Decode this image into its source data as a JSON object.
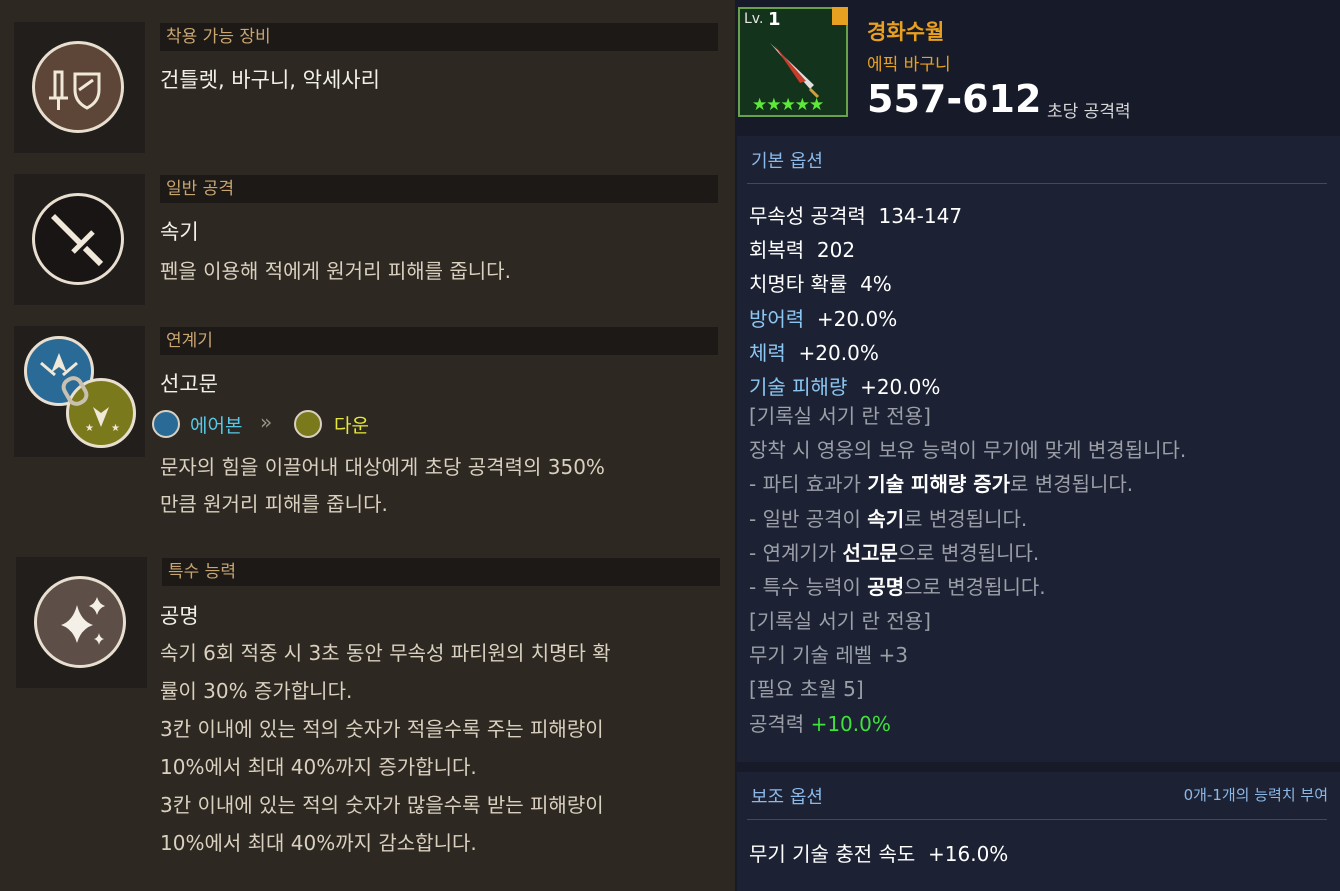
{
  "sections": {
    "equip": {
      "header": "착용 가능 장비",
      "title": "건틀렛, 바구니, 악세사리"
    },
    "attack": {
      "header": "일반 공격",
      "title": "속기",
      "desc": "펜을 이용해 적에게 원거리 피해를 줍니다."
    },
    "chain": {
      "header": "연계기",
      "title": "선고문",
      "from": "에어본",
      "to": "다운",
      "desc1": "문자의 힘을 이끌어내 대상에게 초당 공격력의 350%",
      "desc2": "만큼 원거리 피해를 줍니다."
    },
    "special": {
      "header": "특수 능력",
      "title": "공명",
      "lines": [
        "속기 6회 적중 시 3초 동안 무속성 파티원의 치명타 확",
        "률이 30% 증가합니다.",
        "3칸 이내에 있는 적의 숫자가 적을수록 주는 피해량이",
        "10%에서 최대 40%까지 증가합니다.",
        "3칸 이내에 있는 적의 숫자가 많을수록 받는 피해량이",
        "10%에서 최대 40%까지 감소합니다."
      ]
    }
  },
  "item": {
    "level_label": "Lv.",
    "level": "1",
    "name": "경화수월",
    "rarity": "에픽 바구니",
    "attack": "557-612",
    "attack_label": "초당 공격력",
    "stars": "★★★★★"
  },
  "basic": {
    "header": "기본 옵션",
    "stats": [
      {
        "k": "무속성 공격력",
        "v": "134-147"
      },
      {
        "k": "회복력",
        "v": "202"
      },
      {
        "k": "치명타 확률",
        "v": "4%"
      },
      {
        "k": "방어력",
        "v": "+20.0%"
      },
      {
        "k": "체력",
        "v": "+20.0%"
      },
      {
        "k": "기술 피해량",
        "v": "+20.0%"
      }
    ],
    "note1": "[기록실 서기 란 전용]",
    "note2": "장착 시 영웅의 보유 능력이 무기에 맞게 변경됩니다.",
    "c1_pre": "- 파티 효과가 ",
    "c1_b": "기술 피해량 증가",
    "c1_post": "로 변경됩니다.",
    "c2_pre": "- 일반 공격이 ",
    "c2_b": "속기",
    "c2_post": "로 변경됩니다.",
    "c3_pre": "- 연계기가 ",
    "c3_b": "선고문",
    "c3_post": "으로 변경됩니다.",
    "c4_pre": "- 특수 능력이 ",
    "c4_b": "공명",
    "c4_post": "으로 변경됩니다.",
    "note3": "[기록실 서기 란 전용]",
    "note4": "무기 기술 레벨 +3",
    "note5": "[필요 초월 5]",
    "atk_label": "공격력",
    "atk_val": "+10.0%"
  },
  "sub": {
    "header": "보조 옵션",
    "note": "0개-1개의 능력치 부여",
    "stat_k": "무기 기술 충전 속도",
    "stat_v": "+16.0%"
  },
  "colors": {
    "gold": "#c9a671",
    "option_blue": "#8cc6f2",
    "green": "#3ee23a",
    "rarity": "#e8a020"
  }
}
